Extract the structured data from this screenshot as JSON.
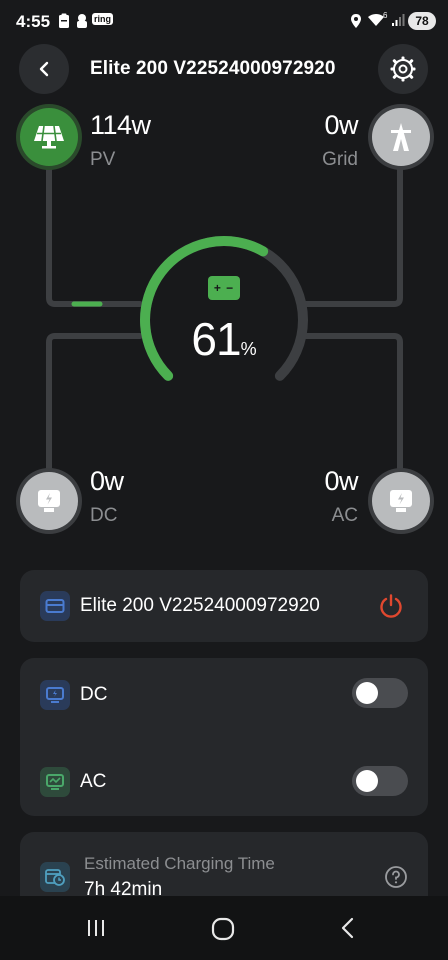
{
  "status_bar": {
    "time": "4:55",
    "notification_badge": "ring",
    "wifi_superscript": "6",
    "battery_level": "78"
  },
  "header": {
    "title": "Elite 200 V22524000972920"
  },
  "flow": {
    "pv": {
      "watts": "114w",
      "label": "PV"
    },
    "grid": {
      "watts": "0w",
      "label": "Grid"
    },
    "dc": {
      "watts": "0w",
      "label": "DC"
    },
    "ac": {
      "watts": "0w",
      "label": "AC"
    },
    "battery_percent": "61",
    "battery_percent_symbol": "%",
    "battery_level_fraction": 0.61,
    "battery_icon_text": "+ −"
  },
  "colors": {
    "accent_green": "#4caf50",
    "power_red": "#e0482f",
    "icon_blue": "#4a7bd0",
    "icon_green": "#4aa86a"
  },
  "device_card": {
    "name": "Elite 200 V22524000972920"
  },
  "outputs_card": {
    "dc_label": "DC",
    "dc_on": false,
    "ac_label": "AC",
    "ac_on": false
  },
  "charging_card": {
    "label": "Estimated Charging Time",
    "value": "7h 42min"
  }
}
